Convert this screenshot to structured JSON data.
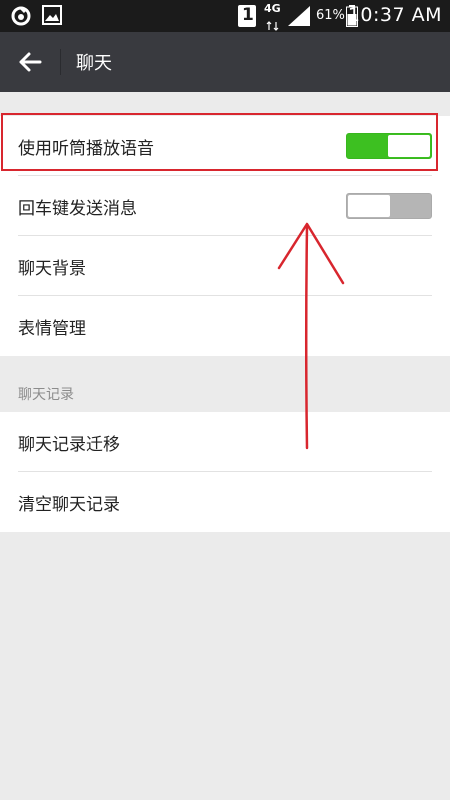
{
  "status_bar": {
    "sim_badge": "1",
    "network": "4G",
    "battery_percent": "61%",
    "time": "10:37 AM"
  },
  "header": {
    "title": "聊天"
  },
  "group1": {
    "items": [
      {
        "label": "使用听筒播放语音",
        "toggle": "on"
      },
      {
        "label": "回车键发送消息",
        "toggle": "off"
      },
      {
        "label": "聊天背景"
      },
      {
        "label": "表情管理"
      }
    ]
  },
  "section": {
    "header": "聊天记录"
  },
  "group2": {
    "items": [
      {
        "label": "聊天记录迁移"
      },
      {
        "label": "清空聊天记录"
      }
    ]
  },
  "colors": {
    "toggle_on": "#3dc021",
    "toggle_off": "#b5b5b5",
    "annotation": "#d8262e",
    "titlebar": "#393a3f"
  }
}
